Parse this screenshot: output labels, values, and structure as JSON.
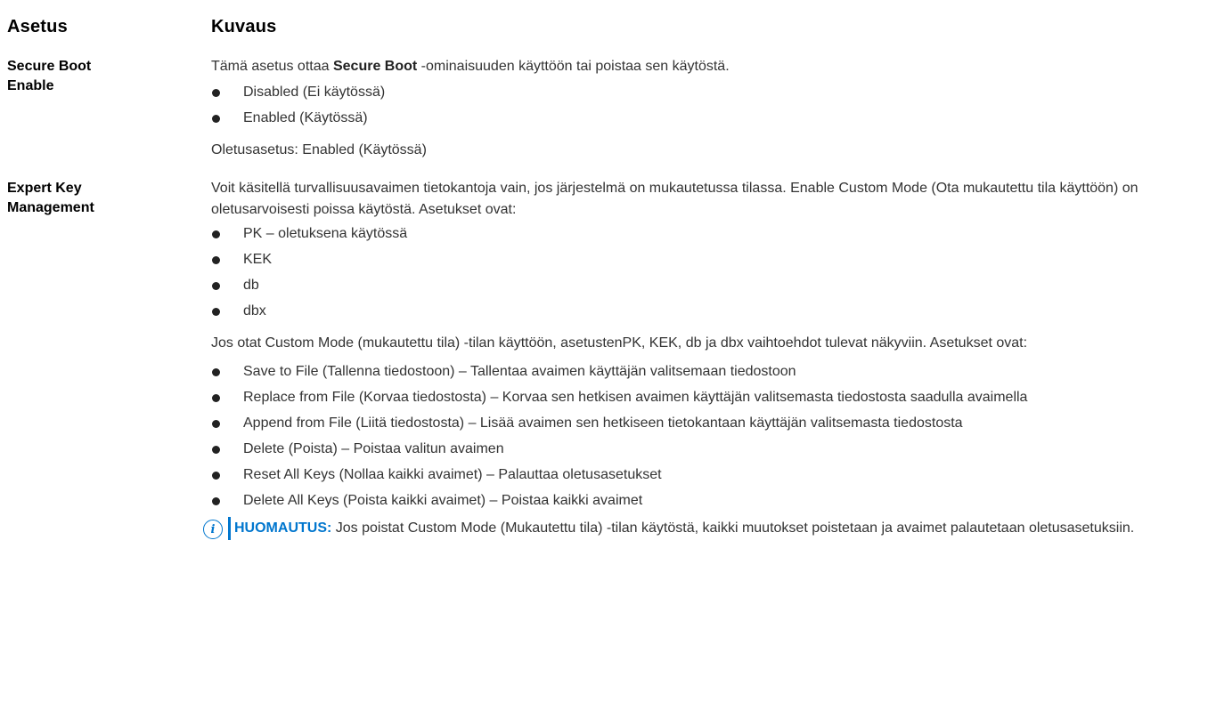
{
  "header": {
    "setting": "Asetus",
    "description": "Kuvaus"
  },
  "rows": [
    {
      "name_line1": "Secure Boot",
      "name_line2": "Enable",
      "intro_before": "Tämä asetus ottaa ",
      "intro_bold": "Secure Boot",
      "intro_after": " -ominaisuuden käyttöön tai poistaa sen käytöstä.",
      "options": [
        "Disabled (Ei käytössä)",
        "Enabled (Käytössä)"
      ],
      "default": "Oletusasetus: Enabled (Käytössä)"
    },
    {
      "name_line1": "Expert Key",
      "name_line2": "Management",
      "intro": "Voit käsitellä turvallisuusavaimen tietokantoja vain, jos järjestelmä on mukautetussa tilassa. Enable Custom Mode (Ota mukautettu tila käyttöön) on oletusarvoisesti poissa käytöstä. Asetukset ovat:",
      "options": [
        "PK – oletuksena käytössä",
        "KEK",
        "db",
        "dbx"
      ],
      "custom_mode_text": "Jos otat Custom Mode (mukautettu tila) -tilan käyttöön, asetustenPK, KEK, db ja dbx vaihtoehdot tulevat näkyviin. Asetukset ovat:",
      "custom_options": [
        "Save to File (Tallenna tiedostoon) – Tallentaa avaimen käyttäjän valitsemaan tiedostoon",
        "Replace from File (Korvaa tiedostosta) – Korvaa sen hetkisen avaimen käyttäjän valitsemasta tiedostosta saadulla avaimella",
        "Append from File (Liitä tiedostosta) – Lisää avaimen sen hetkiseen tietokantaan käyttäjän valitsemasta tiedostosta",
        "Delete (Poista) – Poistaa valitun avaimen",
        "Reset All Keys (Nollaa kaikki avaimet) – Palauttaa oletusasetukset",
        "Delete All Keys (Poista kaikki avaimet) – Poistaa kaikki avaimet"
      ],
      "note_label": "HUOMAUTUS:",
      "note_text": " Jos poistat Custom Mode (Mukautettu tila) -tilan käytöstä, kaikki muutokset poistetaan ja avaimet palautetaan oletusasetuksiin."
    }
  ],
  "icons": {
    "note_icon": "info-circle-icon",
    "note_icon_glyph": "i"
  },
  "colors": {
    "note_accent": "#0076ce"
  }
}
